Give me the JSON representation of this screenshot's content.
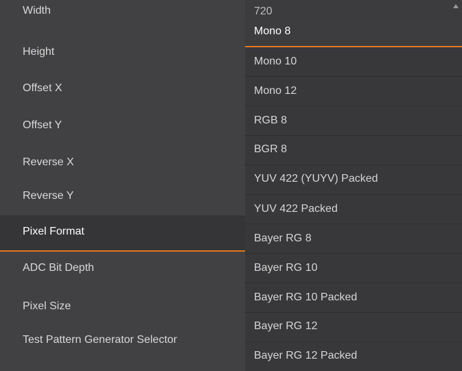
{
  "properties": [
    {
      "label": "Width"
    },
    {
      "label": "Height"
    },
    {
      "label": "Offset X"
    },
    {
      "label": "Offset Y"
    },
    {
      "label": "Reverse X"
    },
    {
      "label": "Reverse Y"
    },
    {
      "label": "Pixel Format"
    },
    {
      "label": "ADC Bit Depth"
    },
    {
      "label": "Pixel Size"
    },
    {
      "label": "Test Pattern Generator Selector"
    }
  ],
  "selected_property": "Pixel Format",
  "width_value": "720",
  "pixel_format_options": [
    {
      "label": "Mono 8"
    },
    {
      "label": "Mono 10"
    },
    {
      "label": "Mono 12"
    },
    {
      "label": "RGB 8"
    },
    {
      "label": "BGR 8"
    },
    {
      "label": "YUV 422 (YUYV) Packed"
    },
    {
      "label": "YUV 422 Packed"
    },
    {
      "label": "Bayer RG 8"
    },
    {
      "label": "Bayer RG 10"
    },
    {
      "label": "Bayer RG 10 Packed"
    },
    {
      "label": "Bayer RG 12"
    },
    {
      "label": "Bayer RG 12 Packed"
    }
  ],
  "highlighted_option": "Mono 8",
  "colors": {
    "accent": "#e07820",
    "panel_bg": "#414143",
    "dropdown_bg": "#38383a"
  },
  "icons": {
    "scroll_up": "scroll-up-arrow-icon"
  }
}
